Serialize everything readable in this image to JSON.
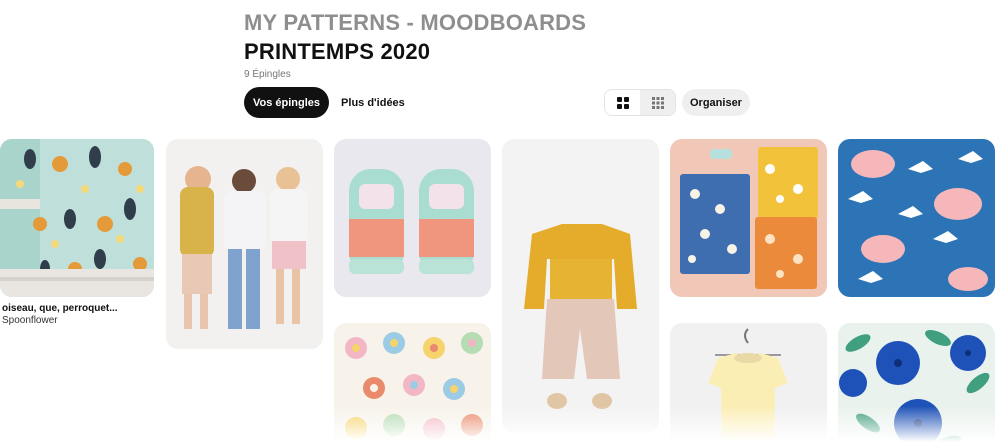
{
  "board": {
    "parent": "MY PATTERNS - MOODBOARDS",
    "title": "PRINTEMPS 2020",
    "pin_count": "9 Épingles"
  },
  "tabs": {
    "your_pins": "Vos épingles",
    "more_ideas": "Plus d'idées"
  },
  "toolbar": {
    "view_large": "grid-large-icon",
    "view_small": "grid-small-icon",
    "organize": "Organiser"
  },
  "pins": [
    {
      "title": "oiseau, que, perroquet...",
      "source": "Spoonflower",
      "description": "parrot-wallpaper"
    },
    {
      "description": "kids-fashion-photo"
    },
    {
      "description": "sneakers-photo"
    },
    {
      "description": "toddler-outfit-photo"
    },
    {
      "description": "floral-notebooks-photo"
    },
    {
      "description": "doves-clouds-pattern"
    },
    {
      "description": "flower-pattern"
    },
    {
      "description": "yellow-top-photo"
    },
    {
      "description": "blueberry-pattern"
    }
  ],
  "colors": {
    "accent_dark": "#111111",
    "muted_gray": "#8e8e8e",
    "button_bg": "#efefef"
  }
}
